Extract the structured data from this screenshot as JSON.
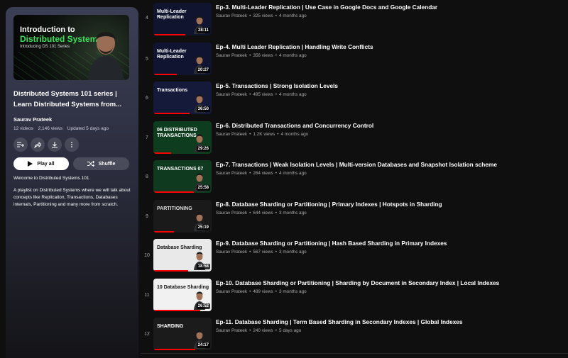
{
  "playlist": {
    "cover": {
      "line1": "Introduction to",
      "line2": "Distributed Systems",
      "line3": "Introducing DS 101 Series"
    },
    "title": "Distributed Systems 101 series | Learn Distributed Systems from...",
    "author": "Saurav Prateek",
    "videos": "12 videos",
    "views": "2,146 views",
    "updated": "Updated 5 days ago",
    "play_all": "Play all",
    "shuffle": "Shuffle",
    "welcome": "Welcome to Distributed Systems 101",
    "description": "A playlist on Distributed Systems where we will talk about concepts like Replication, Transactions, Databases internals, Partitioning and many more from scratch.",
    "icons": [
      "add-to-queue-icon",
      "share-icon",
      "download-icon",
      "more-icon"
    ]
  },
  "videos": [
    {
      "index": "4",
      "title": "Ep-3. Multi-Leader Replication | Use Case in Google Docs and Google Calendar",
      "channel": "Saurav Prateek",
      "views": "325 views",
      "age": "4 months ago",
      "duration": "28:11",
      "thumb_text": "Multi-Leader Replication",
      "thumb_bg": "#10142e",
      "thumb_color": "#ffffff"
    },
    {
      "index": "5",
      "title": "Ep-4. Multi Leader Replication | Handling Write Conflicts",
      "channel": "Saurav Prateek",
      "views": "356 views",
      "age": "4 months ago",
      "duration": "20:27",
      "thumb_text": "Multi-Leader Replication",
      "thumb_bg": "#101430",
      "thumb_color": "#ffffff"
    },
    {
      "index": "6",
      "title": "Ep-5. Transactions | Strong Isolation Levels",
      "channel": "Saurav Prateek",
      "views": "495 views",
      "age": "4 months ago",
      "duration": "36:50",
      "thumb_text": "Transactions",
      "thumb_bg": "#151a3a",
      "thumb_color": "#ffffff"
    },
    {
      "index": "7",
      "title": "Ep-6. Distributed Transactions and Concurrency Control",
      "channel": "Saurav Prateek",
      "views": "1.2K views",
      "age": "4 months ago",
      "duration": "29:26",
      "thumb_text": "06 DISTRIBUTED TRANSACTIONS",
      "thumb_bg": "#0d3d1e",
      "thumb_color": "#ffffff"
    },
    {
      "index": "8",
      "title": "Ep-7. Transactions | Weak Isolation Levels | Multi-version Databases and Snapshot Isolation scheme",
      "channel": "Saurav Prateek",
      "views": "264 views",
      "age": "4 months ago",
      "duration": "25:58",
      "thumb_text": "TRANSACTIONS 07",
      "thumb_bg": "#0f3a20",
      "thumb_color": "#ffffff"
    },
    {
      "index": "9",
      "title": "Ep-8. Database Sharding or Partitioning | Primary Indexes | Hotspots in Sharding",
      "channel": "Saurav Prateek",
      "views": "644 views",
      "age": "3 months ago",
      "duration": "25:19",
      "thumb_text": "PARTITIONING",
      "thumb_bg": "#1a1a1a",
      "thumb_color": "#dddddd"
    },
    {
      "index": "10",
      "title": "Ep-9. Database Sharding or Partitioning | Hash Based Sharding in Primary Indexes",
      "channel": "Saurav Prateek",
      "views": "567 views",
      "age": "3 months ago",
      "duration": "18:58",
      "thumb_text": "Database Sharding",
      "thumb_bg": "#e9e9e9",
      "thumb_color": "#111111"
    },
    {
      "index": "11",
      "title": "Ep-10. Database Sharding or Partitioning | Sharding by Document in Secondary Index | Local Indexes",
      "channel": "Saurav Prateek",
      "views": "489 views",
      "age": "3 months ago",
      "duration": "26:52",
      "thumb_text": "10 Database Sharding",
      "thumb_bg": "#f1f1f1",
      "thumb_color": "#111111"
    },
    {
      "index": "12",
      "title": "Ep-11. Database Sharding | Term Based Sharding in Secondary Indexes | Global Indexes",
      "channel": "Saurav Prateek",
      "views": "240 views",
      "age": "5 days ago",
      "duration": "24:17",
      "thumb_text": "SHARDING",
      "thumb_bg": "#1b1b1b",
      "thumb_color": "#ffffff"
    }
  ]
}
